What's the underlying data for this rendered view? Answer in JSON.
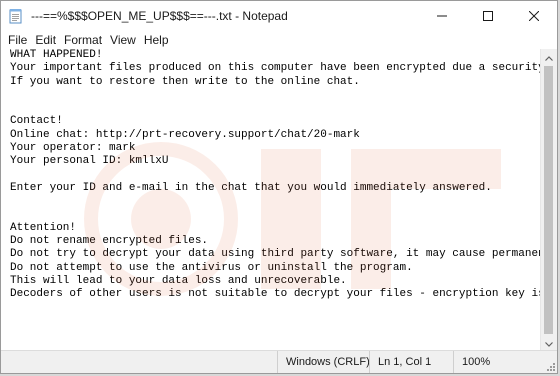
{
  "window": {
    "title": "---==%$$$OPEN_ME_UP$$$==---.txt - Notepad",
    "controls": [
      "minimize",
      "maximize",
      "close"
    ]
  },
  "menu": {
    "items": [
      "File",
      "Edit",
      "Format",
      "View",
      "Help"
    ]
  },
  "document": {
    "lines": [
      "WHAT HAPPENED!",
      "Your important files produced on this computer have been encrypted due a security problem.",
      "If you want to restore then write to the online chat.",
      "",
      "",
      "Contact!",
      "Online chat: http://prt-recovery.support/chat/20-mark",
      "Your operator: mark",
      "Your personal ID: kmllxU",
      "",
      "Enter your ID and e-mail in the chat that you would immediately answered.",
      "",
      "",
      "Attention!",
      "Do not rename encrypted files.",
      "Do not try to decrypt your data using third party software, it may cause permanent data loss.",
      "Do not attempt to use the antivirus or uninstall the program.",
      "This will lead to your data loss and unrecoverable.",
      "Decoders of other users is not suitable to decrypt your files - encryption key is unique."
    ]
  },
  "statusbar": {
    "line_ending": "Windows (CRLF)",
    "position": "Ln 1, Col 1",
    "zoom": "100%"
  },
  "icons": {
    "app": "notepad-icon",
    "minimize": "minimize-icon",
    "maximize": "maximize-icon",
    "close": "close-icon",
    "scroll_up": "chevron-up-icon",
    "scroll_down": "chevron-down-icon"
  },
  "colors": {
    "window_bg": "#ffffff",
    "chrome_bg": "#f0f0f0",
    "text": "#000000",
    "scroll_thumb": "#c1c1c1"
  }
}
